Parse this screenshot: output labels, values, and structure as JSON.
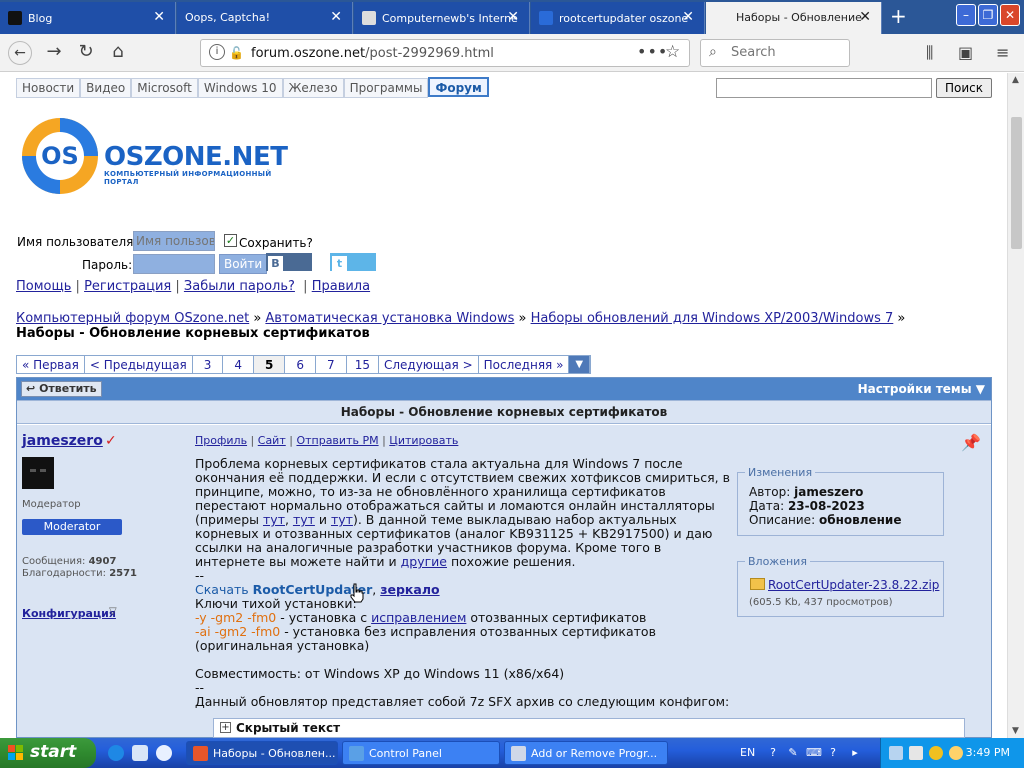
{
  "browser": {
    "tabs": [
      {
        "title": "Blog",
        "active": false
      },
      {
        "title": "Oops, Captcha!",
        "active": false
      },
      {
        "title": "Computernewb's Interne",
        "active": false
      },
      {
        "title": "rootcertupdater oszone",
        "active": false
      },
      {
        "title": "Наборы - Обновление",
        "active": true
      }
    ],
    "new_tab_icon": "plus-icon",
    "url": {
      "host": "forum.oszone.net",
      "path": "/post-2992969.html"
    },
    "search_placeholder": "Search"
  },
  "site": {
    "nav": [
      "Новости",
      "Видео",
      "Microsoft",
      "Windows 10",
      "Железо",
      "Программы",
      "Форум"
    ],
    "nav_active": "Форум",
    "search_button": "Поиск",
    "logo_text": "OSZONE.NET",
    "logo_sub": "КОМПЬЮТЕРНЫЙ ИНФОРМАЦИОННЫЙ ПОРТАЛ",
    "logo_badge": "OS"
  },
  "login": {
    "username_label": "Имя пользователя:",
    "username_placeholder": "Имя пользова",
    "password_label": "Пароль:",
    "remember_label": "Сохранить?",
    "login_button": "Войти",
    "vk_button": "Войти",
    "vk_letter": "B",
    "twitter_button": "Войти",
    "twitter_letter": "t"
  },
  "links": [
    "Помощь",
    "Регистрация",
    "Забыли пароль?",
    "Правила"
  ],
  "breadcrumbs": {
    "items": [
      "Компьютерный форум OSzone.net",
      "Автоматическая установка Windows",
      "Наборы обновлений для Windows XP/2003/Windows 7"
    ],
    "current": "Наборы - Обновление корневых сертификатов"
  },
  "pager": {
    "first": "« Первая",
    "prev": "< Предыдущая",
    "pages": [
      "3",
      "4",
      "5",
      "6",
      "7",
      "15"
    ],
    "current": "5",
    "next": "Следующая >",
    "last": "Последняя »"
  },
  "thread": {
    "reply_button": "Ответить",
    "settings": "Настройки темы",
    "title": "Наборы - Обновление корневых сертификатов"
  },
  "post": {
    "author": "jameszero",
    "role": "Модератор",
    "role_badge": "Moderator",
    "messages_label": "Сообщения:",
    "messages_count": "4907",
    "thanks_label": "Благодарности:",
    "thanks_count": "2571",
    "config": "Конфигурация",
    "actions": [
      "Профиль",
      "Сайт",
      "Отправить PM",
      "Цитировать"
    ],
    "body": {
      "p1_before": "Проблема корневых сертификатов стала актуальна для Windows 7 после окончания её поддержки. И если с отсутствием свежих хотфиксов смириться, в принципе, можно, то из-за не обновлённого хранилища сертификатов перестают нормально отображаться сайты и ломаются онлайн инсталляторы (примеры ",
      "p1_links": [
        "тут",
        "тут",
        "тут"
      ],
      "p1_sep1": ", ",
      "p1_sep2": " и ",
      "p1_after": "). В данной теме выкладываю набор актуальных корневых и отозванных сертификатов (аналог KB931125 + KB2917500) и даю ссылки на аналогичные разработки участников форума. Кроме того в интернете вы можете найти и ",
      "p1_link_other": "другие",
      "p1_end": " похожие решения.",
      "dashes": "--",
      "download_prefix": "Скачать ",
      "download_link": "RootCertUpdater",
      "download_sep": ", ",
      "mirror_link": "зеркало",
      "keys_title": "Ключи тихой установки:",
      "key1_flags": "-y -gm2 -fm0",
      "key1_text_a": " - установка с ",
      "key1_link": "исправлением",
      "key1_text_b": " отозванных сертификатов",
      "key2_flags": "-ai -gm2 -fm0",
      "key2_text": " - установка без исправления отозванных сертификатов (оригинальная установка)",
      "compat": "Совместимость: от Windows XP до Windows 11 (x86/x64)",
      "dashes2": "--",
      "desc": "Данный обновлятор представляет собой 7z SFX архив со следующим конфигом:",
      "hidden": "Скрытый текст"
    },
    "changes": {
      "legend": "Изменения",
      "author_label": "Автор:",
      "author": "jameszero",
      "date_label": "Дата:",
      "date": "23-08-2023",
      "desc_label": "Описание:",
      "desc": "обновление"
    },
    "attachments": {
      "legend": "Вложения",
      "file": "RootCertUpdater-23.8.22.zip",
      "meta": "(605.5 Kb, 437 просмотров)"
    }
  },
  "taskbar": {
    "start": "start",
    "tasks": [
      {
        "label": "Наборы - Обновлен...",
        "active": true
      },
      {
        "label": "Control Panel",
        "active": false
      },
      {
        "label": "Add or Remove Progr...",
        "active": false
      }
    ],
    "lang": "EN",
    "clock": "3:49 PM"
  },
  "colors": {
    "accent": "#4f85c9",
    "post_bg": "#dae4f3",
    "link": "#22229c",
    "orange": "#e07010"
  }
}
